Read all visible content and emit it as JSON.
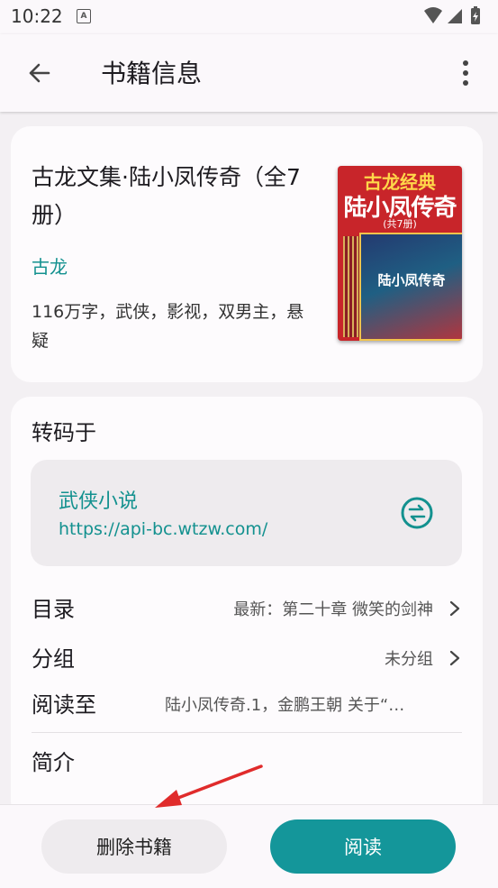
{
  "status_bar": {
    "time": "10:22",
    "notification_icon": "A"
  },
  "app_bar": {
    "title": "书籍信息",
    "back_icon": "arrow-left",
    "more_icon": "more-vert"
  },
  "book": {
    "title": "古龙文集·陆小凤传奇（全7册）",
    "author": "古龙",
    "tags": "116万字，武侠，影视，双男主，悬疑",
    "cover": {
      "top_text": "古龙经典",
      "main_text": "陆小凤传奇",
      "sub_text": "(共7册)",
      "box_text": "陆小凤传奇"
    }
  },
  "detail": {
    "source_heading": "转码于",
    "source_name": "武侠小说",
    "source_url": "https://api-bc.wtzw.com/",
    "rows": [
      {
        "label": "目录",
        "value": "最新：第二十章 微笑的剑神"
      },
      {
        "label": "分组",
        "value": "未分组"
      },
      {
        "label": "阅读至",
        "value": "陆小凤传奇.1，金鹏王朝 关于“…"
      }
    ],
    "intro_heading": "简介"
  },
  "actions": {
    "delete_label": "删除书籍",
    "read_label": "阅读"
  },
  "colors": {
    "accent": "#14969a",
    "link": "#13918f",
    "annotation_arrow": "#e02b2b"
  }
}
